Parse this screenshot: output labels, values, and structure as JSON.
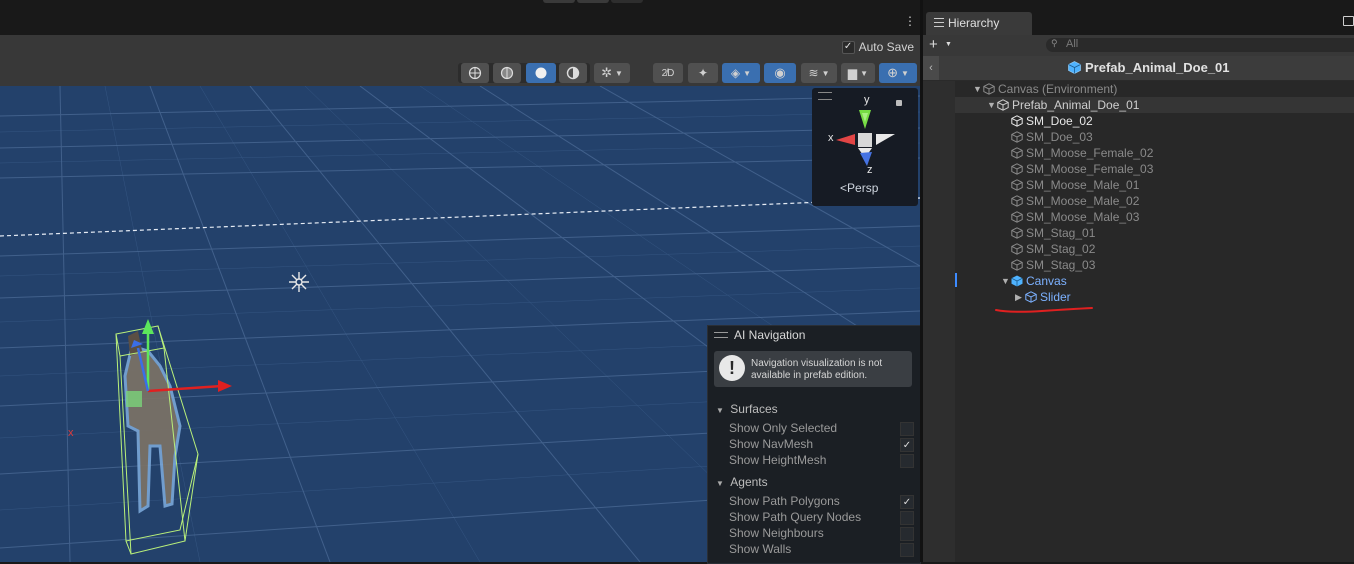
{
  "scene": {
    "auto_save_label": "Auto Save",
    "auto_save_checked": true,
    "gizmo": {
      "axis_y": "y",
      "axis_x": "x",
      "axis_z": "z",
      "projection_label": "Persp"
    },
    "stray_marker": "x"
  },
  "ai_navigation": {
    "title": "AI Navigation",
    "message": "Navigation visualization is not available in prefab edition.",
    "sections": [
      {
        "title": "Surfaces",
        "options": [
          {
            "label": "Show Only Selected",
            "checked": false
          },
          {
            "label": "Show NavMesh",
            "checked": true
          },
          {
            "label": "Show HeightMesh",
            "checked": false
          }
        ]
      },
      {
        "title": "Agents",
        "options": [
          {
            "label": "Show Path Polygons",
            "checked": true
          },
          {
            "label": "Show Path Query Nodes",
            "checked": false
          },
          {
            "label": "Show Neighbours",
            "checked": false
          },
          {
            "label": "Show Walls",
            "checked": false
          }
        ]
      }
    ]
  },
  "hierarchy": {
    "tab_label": "Hierarchy",
    "search_placeholder": "All",
    "prefab_title": "Prefab_Animal_Doe_01",
    "items": [
      {
        "label": "Canvas (Environment)",
        "indent": 0,
        "arrow": "down",
        "style": "dim",
        "icon": "cube-outline"
      },
      {
        "label": "Prefab_Animal_Doe_01",
        "indent": 1,
        "arrow": "down",
        "style": "normal",
        "icon": "cube-outline"
      },
      {
        "label": "SM_Doe_02",
        "indent": 2,
        "arrow": "",
        "style": "bright",
        "icon": "cube-outline"
      },
      {
        "label": "SM_Doe_03",
        "indent": 2,
        "arrow": "",
        "style": "dim",
        "icon": "cube-outline"
      },
      {
        "label": "SM_Moose_Female_02",
        "indent": 2,
        "arrow": "",
        "style": "dim",
        "icon": "cube-outline"
      },
      {
        "label": "SM_Moose_Female_03",
        "indent": 2,
        "arrow": "",
        "style": "dim",
        "icon": "cube-outline"
      },
      {
        "label": "SM_Moose_Male_01",
        "indent": 2,
        "arrow": "",
        "style": "dim",
        "icon": "cube-outline"
      },
      {
        "label": "SM_Moose_Male_02",
        "indent": 2,
        "arrow": "",
        "style": "dim",
        "icon": "cube-outline"
      },
      {
        "label": "SM_Moose_Male_03",
        "indent": 2,
        "arrow": "",
        "style": "dim",
        "icon": "cube-outline"
      },
      {
        "label": "SM_Stag_01",
        "indent": 2,
        "arrow": "",
        "style": "dim",
        "icon": "cube-outline"
      },
      {
        "label": "SM_Stag_02",
        "indent": 2,
        "arrow": "",
        "style": "dim",
        "icon": "cube-outline"
      },
      {
        "label": "SM_Stag_03",
        "indent": 2,
        "arrow": "",
        "style": "dim",
        "icon": "cube-outline"
      },
      {
        "label": "Canvas",
        "indent": 2,
        "arrow": "down",
        "style": "blue",
        "icon": "cube-blue"
      },
      {
        "label": "Slider",
        "indent": 3,
        "arrow": "right",
        "style": "blue",
        "icon": "cube-outline"
      }
    ]
  },
  "colors": {
    "viewport_bg": "#23416b",
    "accent_blue": "#6fa8ff",
    "annotation_red": "#e02020"
  }
}
